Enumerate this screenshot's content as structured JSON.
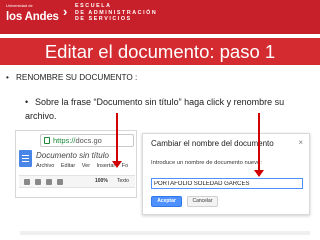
{
  "header": {
    "logo_top": "Universidad de",
    "logo_main": "los Andes",
    "separator": "›",
    "school_lines": [
      "ESCUELA",
      "DE ADMINISTRACIÓN",
      "DE SERVICIOS"
    ]
  },
  "slide": {
    "title": "Editar el documento: paso 1",
    "bullet_main": "RENOMBRE SU DOCUMENTO :",
    "bullet_sub": "Sobre la frase “Documento sin título” haga click y renombre su archivo."
  },
  "docs_screenshot": {
    "url": "https://docs.go",
    "url_secure_part": "https://",
    "url_rest_part": "docs.go",
    "doc_title": "Documento sin título",
    "menu": [
      "Archivo",
      "Editar",
      "Ver",
      "Insertar",
      "Fo"
    ],
    "zoom": "100%",
    "style": "Texto"
  },
  "rename_dialog": {
    "title": "Cambiar el nombre del documento",
    "close": "×",
    "prompt": "Introduce un nombre de documento nuevo:",
    "value": "PORTAFOLIO SOLEDAD GARCES",
    "accept": "Aceptar",
    "cancel": "Cancelar"
  },
  "colors": {
    "header_red": "#c8202a",
    "title_red": "#d42b31",
    "arrow_red": "#d00000",
    "accept_blue": "#4d90fe"
  }
}
